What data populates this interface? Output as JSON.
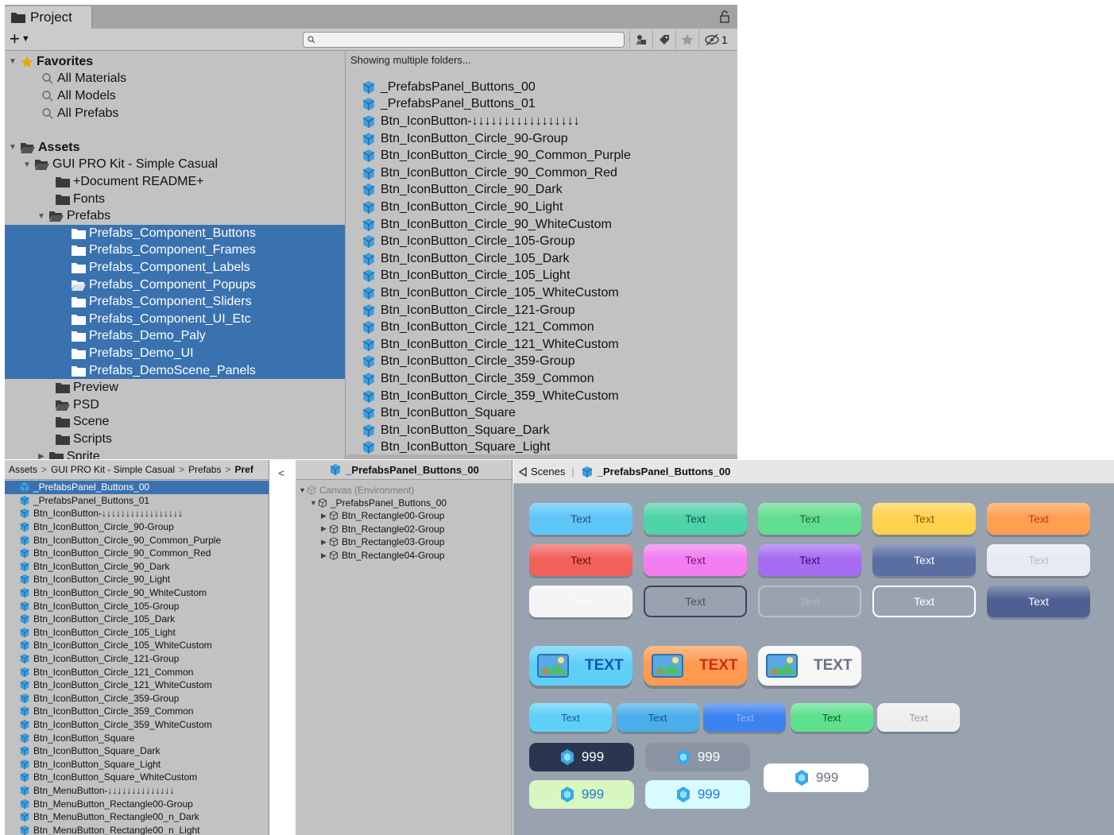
{
  "project": {
    "tab_label": "Project",
    "add_label": "+",
    "search_placeholder": "",
    "tree": {
      "favorites_label": "Favorites",
      "fav_items": [
        "All Materials",
        "All Models",
        "All Prefabs"
      ],
      "assets_label": "Assets",
      "kit_label": "GUI PRO Kit - Simple Casual",
      "doc_label": "+Document README+",
      "fonts_label": "Fonts",
      "prefabs_label": "Prefabs",
      "prefab_folders": [
        "Prefabs_Component_Buttons",
        "Prefabs_Component_Frames",
        "Prefabs_Component_Labels",
        "Prefabs_Component_Popups",
        "Prefabs_Component_Sliders",
        "Prefabs_Component_UI_Etc",
        "Prefabs_Demo_Paly",
        "Prefabs_Demo_UI",
        "Prefabs_DemoScene_Panels"
      ],
      "other_folders": [
        "Preview",
        "PSD",
        "Scene",
        "Scripts",
        "Sprite"
      ]
    },
    "showing_label": "Showing multiple folders...",
    "assets": [
      "_PrefabsPanel_Buttons_00",
      "_PrefabsPanel_Buttons_01",
      "Btn_IconButton-↓↓↓↓↓↓↓↓↓↓↓↓↓↓↓↓↓",
      "Btn_IconButton_Circle_90-Group",
      "Btn_IconButton_Circle_90_Common_Purple",
      "Btn_IconButton_Circle_90_Common_Red",
      "Btn_IconButton_Circle_90_Dark",
      "Btn_IconButton_Circle_90_Light",
      "Btn_IconButton_Circle_90_WhiteCustom",
      "Btn_IconButton_Circle_105-Group",
      "Btn_IconButton_Circle_105_Dark",
      "Btn_IconButton_Circle_105_Light",
      "Btn_IconButton_Circle_105_WhiteCustom",
      "Btn_IconButton_Circle_121-Group",
      "Btn_IconButton_Circle_121_Common",
      "Btn_IconButton_Circle_121_WhiteCustom",
      "Btn_IconButton_Circle_359-Group",
      "Btn_IconButton_Circle_359_Common",
      "Btn_IconButton_Circle_359_WhiteCustom",
      "Btn_IconButton_Square",
      "Btn_IconButton_Square_Dark",
      "Btn_IconButton_Square_Light"
    ]
  },
  "lower": {
    "breadcrumb": [
      "Assets",
      "GUI PRO Kit - Simple Casual",
      "Prefabs",
      "Pref"
    ],
    "list": [
      "_PrefabsPanel_Buttons_00",
      "_PrefabsPanel_Buttons_01",
      "Btn_IconButton-↓↓↓↓↓↓↓↓↓↓↓↓↓↓↓↓↓",
      "Btn_IconButton_Circle_90-Group",
      "Btn_IconButton_Circle_90_Common_Purple",
      "Btn_IconButton_Circle_90_Common_Red",
      "Btn_IconButton_Circle_90_Dark",
      "Btn_IconButton_Circle_90_Light",
      "Btn_IconButton_Circle_90_WhiteCustom",
      "Btn_IconButton_Circle_105-Group",
      "Btn_IconButton_Circle_105_Dark",
      "Btn_IconButton_Circle_105_Light",
      "Btn_IconButton_Circle_105_WhiteCustom",
      "Btn_IconButton_Circle_121-Group",
      "Btn_IconButton_Circle_121_Common",
      "Btn_IconButton_Circle_121_WhiteCustom",
      "Btn_IconButton_Circle_359-Group",
      "Btn_IconButton_Circle_359_Common",
      "Btn_IconButton_Circle_359_WhiteCustom",
      "Btn_IconButton_Square",
      "Btn_IconButton_Square_Dark",
      "Btn_IconButton_Square_Light",
      "Btn_IconButton_Square_WhiteCustom",
      "Btn_MenuButton-↓↓↓↓↓↓↓↓↓↓↓↓↓↓",
      "Btn_MenuButton_Rectangle00-Group",
      "Btn_MenuButton_Rectangle00_n_Dark",
      "Btn_MenuButton_Rectangle00_n_Light"
    ]
  },
  "hierarchy": {
    "title": "_PrefabsPanel_Buttons_00",
    "canvas_label": "Canvas (Environment)",
    "root_label": "_PrefabsPanel_Buttons_00",
    "children": [
      "Btn_Rectangle00-Group",
      "Btn_Rectangle02-Group",
      "Btn_Rectangle03-Group",
      "Btn_Rectangle04-Group"
    ]
  },
  "scene": {
    "scenes_label": "Scenes",
    "title": "_PrefabsPanel_Buttons_00",
    "button_text": "Text",
    "icon_button_text": "TEXT",
    "currency_value": "999"
  },
  "colors": {
    "selection": "#3a72b0",
    "folder": "#3a3a3a",
    "prefab_icon": "#3d9ee0",
    "scene_bg": "#98a3af"
  }
}
